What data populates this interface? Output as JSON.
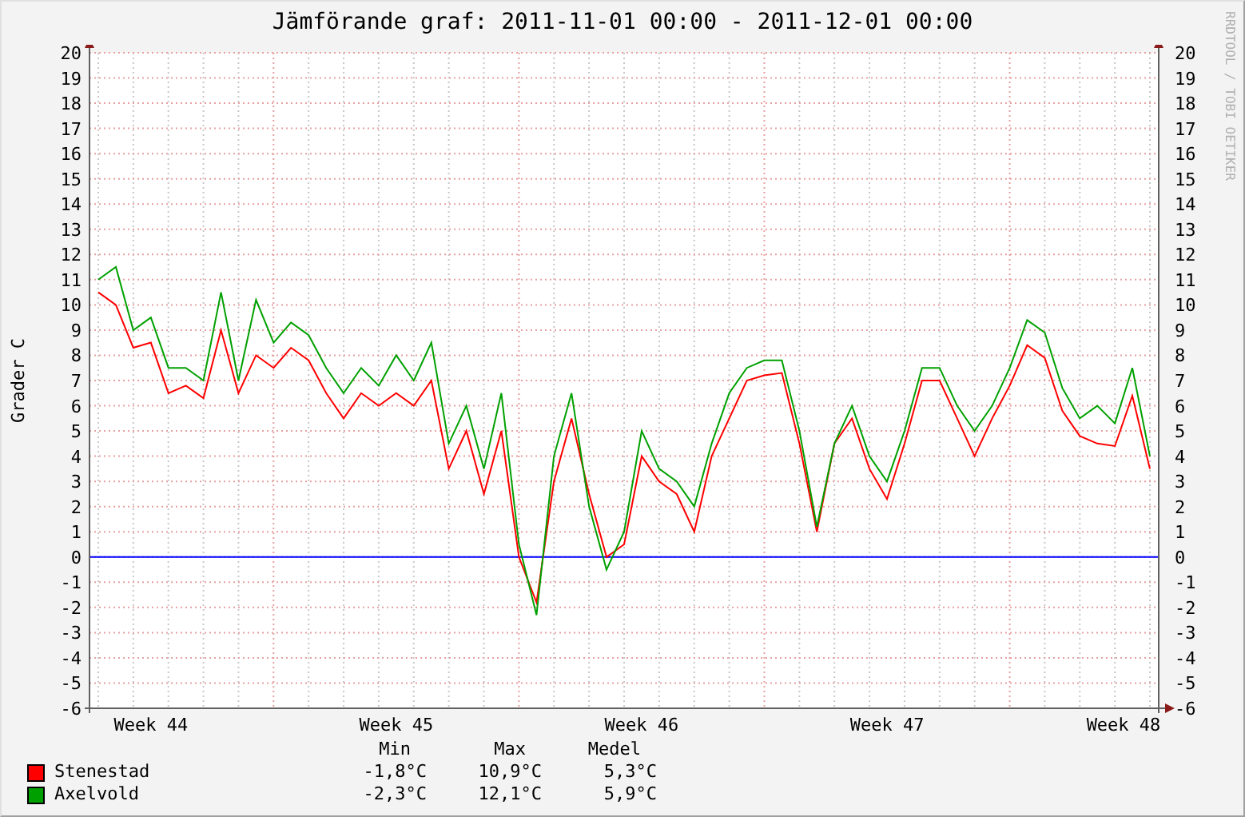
{
  "title": "Jämförande graf: 2011-11-01 00:00 - 2011-12-01 00:00",
  "credit": "RRDTOOL / TOBI OETIKER",
  "chart_data": {
    "type": "line",
    "ylabel": "Grader C",
    "ylim": [
      -6,
      20
    ],
    "yticks": [
      -6,
      -5,
      -4,
      -3,
      -2,
      -1,
      0,
      1,
      2,
      3,
      4,
      5,
      6,
      7,
      8,
      9,
      10,
      11,
      12,
      13,
      14,
      15,
      16,
      17,
      18,
      19,
      20
    ],
    "categories": [
      null,
      null,
      null,
      "Week 44",
      null,
      null,
      null,
      null,
      null,
      null,
      null,
      null,
      null,
      null,
      null,
      null,
      null,
      "Week 45",
      null,
      null,
      null,
      null,
      null,
      null,
      null,
      null,
      null,
      null,
      null,
      null,
      null,
      "Week 46",
      null,
      null,
      null,
      null,
      null,
      null,
      null,
      null,
      null,
      null,
      null,
      null,
      null,
      "Week 47",
      null,
      null,
      null,
      null,
      null,
      null,
      null,
      null,
      null,
      null,
      null,
      null,
      null,
      "Week 48",
      null
    ],
    "series": [
      {
        "name": "Stenestad",
        "color": "#ff0000",
        "values": [
          10.5,
          10,
          8.3,
          8.5,
          6.5,
          6.8,
          6.3,
          9,
          6.5,
          8,
          7.5,
          8.3,
          7.8,
          6.5,
          5.5,
          6.5,
          6,
          6.5,
          6,
          7,
          3.5,
          5,
          2.5,
          5,
          0,
          -1.8,
          3,
          5.5,
          2.5,
          0,
          0.5,
          4,
          3,
          2.5,
          1,
          4,
          5.5,
          7,
          7.2,
          7.3,
          4.5,
          1,
          4.5,
          5.5,
          3.5,
          2.3,
          4.5,
          7,
          7,
          5.5,
          4,
          5.5,
          6.8,
          8.4,
          7.9,
          5.8,
          4.8,
          4.5,
          4.4,
          6.4,
          3.5
        ]
      },
      {
        "name": "Axelvold",
        "color": "#00a000",
        "values": [
          11,
          11.5,
          9,
          9.5,
          7.5,
          7.5,
          7,
          10.5,
          7,
          10.2,
          8.5,
          9.3,
          8.8,
          7.5,
          6.5,
          7.5,
          6.8,
          8,
          7,
          8.5,
          4.5,
          6,
          3.5,
          6.5,
          0.5,
          -2.3,
          4,
          6.5,
          2,
          -0.5,
          1,
          5,
          3.5,
          3,
          2,
          4.5,
          6.5,
          7.5,
          7.8,
          7.8,
          5,
          1.2,
          4.5,
          6,
          4,
          3,
          5,
          7.5,
          7.5,
          6,
          5,
          6,
          7.5,
          9.4,
          8.9,
          6.7,
          5.5,
          6,
          5.3,
          7.5,
          4
        ]
      }
    ],
    "ref_lines": [
      {
        "axis": "y",
        "value": 0,
        "color": "#0000ff"
      }
    ],
    "grid": true
  },
  "right_axis_labels": [
    "20",
    "19",
    "18",
    "17",
    "16",
    "15",
    "14",
    "13",
    "12",
    "11",
    "10",
    "9",
    "8",
    "7",
    "6",
    "5",
    "4",
    "3",
    "2",
    "1",
    "0",
    "-1",
    "-2",
    "-3",
    "-4",
    "-5",
    "-6"
  ],
  "legend": {
    "columns": [
      "Min",
      "Max",
      "Medel"
    ],
    "rows": [
      {
        "values": [
          "-1,8°C",
          "10,9°C",
          "5,3°C"
        ]
      },
      {
        "values": [
          "-2,3°C",
          "12,1°C",
          "5,9°C"
        ]
      }
    ]
  }
}
